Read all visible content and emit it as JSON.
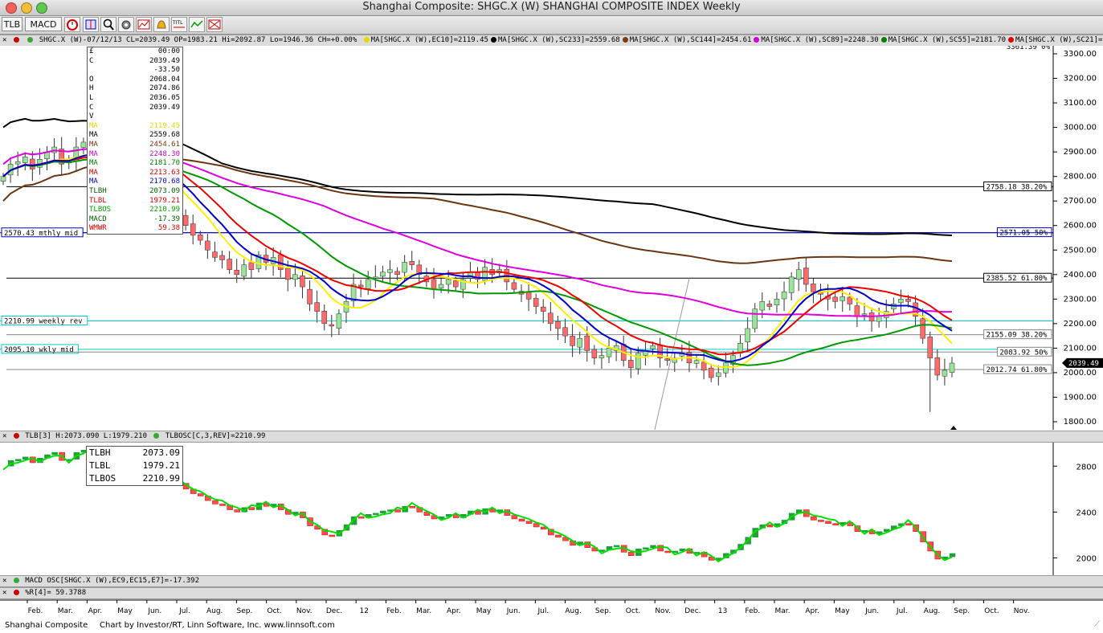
{
  "window": {
    "title": "Shanghai Composite: SHGC.X (W) SHANGHAI COMPOSITE INDEX Weekly"
  },
  "toolbar": {
    "tlb_label": "TLB",
    "macd_label": "MACD"
  },
  "legend": {
    "main": "SHGC.X (W)-07/12/13 CL=2039.49 OP=1983.21 Hi=2092.87 Lo=1946.36 CH=+0.00%",
    "ma": [
      {
        "text": "MA[SHGC.X (W),EC10]=2119.45",
        "color": "#e6d800"
      },
      {
        "text": "MA[SHGC.X (W),SC233]=2559.68",
        "color": "#000000"
      },
      {
        "text": "MA[SHGC.X (W),SC144]=2454.61",
        "color": "#7a3a10"
      },
      {
        "text": "MA[SHGC.X (W),SC89]=2248.30",
        "color": "#d000d0"
      },
      {
        "text": "MA[SHGC.X (W),SC55]=2181.70",
        "color": "#008000"
      },
      {
        "text": "MA[SHGC.X (W),SC21]=2213.63",
        "color": "#dd0000"
      }
    ],
    "tlb": "TLB[3] H:2073.090 L:1979.210",
    "tlbosc": "TLBOSC[C,3,REV]=2210.99",
    "macd": "MACD OSC[SHGC.X (W),EC9,EC15,E7]=-17.392",
    "wr": "%R[4]= 59.3788"
  },
  "databox": [
    {
      "label": "£",
      "value": "00:00",
      "color": "#000"
    },
    {
      "label": "C",
      "value": "2039.49",
      "color": "#000"
    },
    {
      "label": "",
      "value": "-33.50",
      "color": "#000"
    },
    {
      "label": "O",
      "value": "2068.04",
      "color": "#000"
    },
    {
      "label": "H",
      "value": "2074.86",
      "color": "#000"
    },
    {
      "label": "L",
      "value": "2036.05",
      "color": "#000"
    },
    {
      "label": "C",
      "value": "2039.49",
      "color": "#000"
    },
    {
      "label": "V",
      "value": "",
      "color": "#000"
    },
    {
      "label": "MA",
      "value": "2119.45",
      "color": "#e6d800"
    },
    {
      "label": "MA",
      "value": "2559.68",
      "color": "#000000"
    },
    {
      "label": "MA",
      "value": "2454.61",
      "color": "#7a3a10"
    },
    {
      "label": "MA",
      "value": "2248.30",
      "color": "#d000d0"
    },
    {
      "label": "MA",
      "value": "2181.70",
      "color": "#008000"
    },
    {
      "label": "MA",
      "value": "2213.63",
      "color": "#dd0000"
    },
    {
      "label": "MA",
      "value": "2170.68",
      "color": "#0000cc"
    },
    {
      "label": "TLBH",
      "value": "2073.09",
      "color": "#006000"
    },
    {
      "label": "TLBL",
      "value": "1979.21",
      "color": "#dd0000"
    },
    {
      "label": "TLBOS",
      "value": "2210.99",
      "color": "#00a000"
    },
    {
      "label": "MACD",
      "value": "-17.39",
      "color": "#006000"
    },
    {
      "label": "WMWR",
      "value": "59.38",
      "color": "#dd0000"
    }
  ],
  "tlbbox": [
    {
      "label": "TLBH",
      "value": "2073.09"
    },
    {
      "label": "TLBL",
      "value": "1979.21"
    },
    {
      "label": "TLBOS",
      "value": "2210.99"
    }
  ],
  "footer": {
    "name": "Shanghai Composite",
    "credit": "Chart by Investor/RT, Linn Software, Inc. www.linnsoft.com"
  },
  "chart_data": {
    "type": "candlestick",
    "title": "Shanghai Composite: SHGC.X (W) SHANGHAI COMPOSITE INDEX Weekly",
    "price_axis": {
      "ticks": [
        1800,
        1900,
        2000,
        2100,
        2200,
        2300,
        2400,
        2500,
        2600,
        2700,
        2800,
        2900,
        3000,
        3100,
        3200,
        3300
      ],
      "top_label": "3361.39 0%"
    },
    "last_price_label": "2039.49",
    "x_labels": [
      "Feb.",
      "Mar.",
      "Apr.",
      "May",
      "Jun.",
      "Jul.",
      "Aug.",
      "Sep.",
      "Oct.",
      "Nov.",
      "Dec.",
      "12",
      "Feb.",
      "Mar.",
      "Apr.",
      "May",
      "Jun.",
      "Jul.",
      "Aug.",
      "Sep.",
      "Oct.",
      "Nov.",
      "Dec.",
      "13",
      "Feb.",
      "Mar.",
      "Apr.",
      "May",
      "Jun.",
      "Jul.",
      "Aug.",
      "Sep.",
      "Oct.",
      "Nov."
    ],
    "hlines": [
      {
        "price": 2758.18,
        "label": "2758.18 38.20%",
        "color": "#000000",
        "side": "right"
      },
      {
        "price": 2571.05,
        "label": "2571.05 50%",
        "color": "#0000cc",
        "side": "right"
      },
      {
        "price": 2570.43,
        "label": "2570.43 mthly mid",
        "color": "#0000cc",
        "side": "left"
      },
      {
        "price": 2385.52,
        "label": "2385.52 61.80%",
        "color": "#000000",
        "side": "right"
      },
      {
        "price": 2210.99,
        "label": "2210.99 weekly rev",
        "color": "#00cccc",
        "side": "left"
      },
      {
        "price": 2155.09,
        "label": "2155.09 38.20%",
        "color": "#888888",
        "side": "right"
      },
      {
        "price": 2095.1,
        "label": "2095.10 wkly mid",
        "color": "#00cccc",
        "side": "left"
      },
      {
        "price": 2083.92,
        "label": "2083.92 50%",
        "color": "#888888",
        "side": "right"
      },
      {
        "price": 2012.74,
        "label": "2012.74 61.80%",
        "color": "#888888",
        "side": "right"
      }
    ],
    "close": [
      2800,
      2850,
      2860,
      2880,
      2830,
      2870,
      2900,
      2920,
      2850,
      2860,
      2920,
      2940,
      2910,
      2870,
      2890,
      2870,
      2860,
      2880,
      2800,
      2790,
      2760,
      2770,
      2760,
      2700,
      2650,
      2600,
      2560,
      2540,
      2500,
      2470,
      2460,
      2420,
      2400,
      2440,
      2420,
      2480,
      2450,
      2470,
      2420,
      2380,
      2400,
      2350,
      2280,
      2250,
      2200,
      2190,
      2240,
      2290,
      2360,
      2350,
      2380,
      2390,
      2410,
      2420,
      2400,
      2450,
      2440,
      2400,
      2370,
      2340,
      2360,
      2380,
      2350,
      2380,
      2410,
      2380,
      2430,
      2400,
      2420,
      2370,
      2340,
      2320,
      2300,
      2270,
      2250,
      2200,
      2180,
      2150,
      2110,
      2140,
      2090,
      2060,
      2070,
      2100,
      2110,
      2050,
      2020,
      2080,
      2090,
      2110,
      2060,
      2050,
      2060,
      2080,
      2040,
      2050,
      2010,
      1980,
      2000,
      2040,
      2070,
      2120,
      2180,
      2260,
      2290,
      2270,
      2300,
      2330,
      2390,
      2420,
      2360,
      2330,
      2320,
      2300,
      2290,
      2310,
      2280,
      2230,
      2240,
      2210,
      2230,
      2250,
      2280,
      2300,
      2290,
      2230,
      2140,
      2060,
      1990,
      2010,
      2039
    ],
    "ma_series": [
      {
        "name": "EC10",
        "color": "#ffee00",
        "last": 2119.45
      },
      {
        "name": "SC233",
        "color": "#000000",
        "last": 2559.68
      },
      {
        "name": "SC144",
        "color": "#6b3510",
        "last": 2454.61
      },
      {
        "name": "SC89",
        "color": "#dd00dd",
        "last": 2248.3
      },
      {
        "name": "SC55",
        "color": "#009900",
        "last": 2181.7
      },
      {
        "name": "SC21",
        "color": "#ee0000",
        "last": 2213.63
      },
      {
        "name": "MA",
        "color": "#0000cc",
        "last": 2170.68
      }
    ],
    "tlb_axis": {
      "ticks": [
        2000,
        2400,
        2800
      ]
    }
  }
}
